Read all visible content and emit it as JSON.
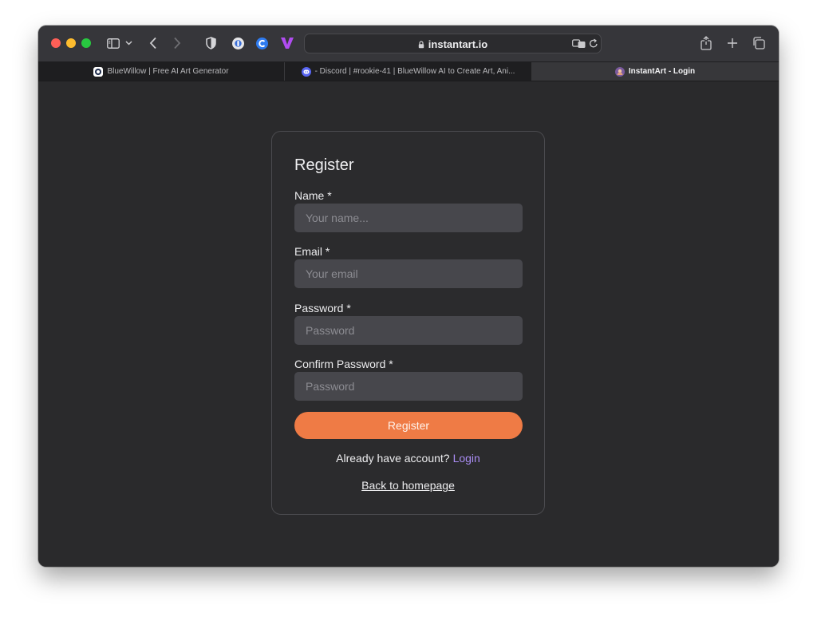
{
  "browser": {
    "address": "instantart.io",
    "tabs": [
      {
        "label": "BlueWillow | Free AI Art Generator",
        "icon": "bluewillow-icon"
      },
      {
        "label": "- Discord | #rookie-41 | BlueWillow AI to Create Art, Ani...",
        "icon": "discord-icon"
      },
      {
        "label": "InstantArt - Login",
        "icon": "instantart-icon",
        "active": true
      }
    ]
  },
  "form": {
    "title": "Register",
    "fields": [
      {
        "label": "Name *",
        "placeholder": "Your name..."
      },
      {
        "label": "Email *",
        "placeholder": "Your email"
      },
      {
        "label": "Password *",
        "placeholder": "Password"
      },
      {
        "label": "Confirm Password *",
        "placeholder": "Password"
      }
    ],
    "submit_label": "Register",
    "login_prompt": "Already have account?",
    "login_link": "Login",
    "back_link": "Back to homepage"
  },
  "colors": {
    "accent": "#ef7b45",
    "link": "#a98cf3",
    "background": "#2a2a2c"
  }
}
